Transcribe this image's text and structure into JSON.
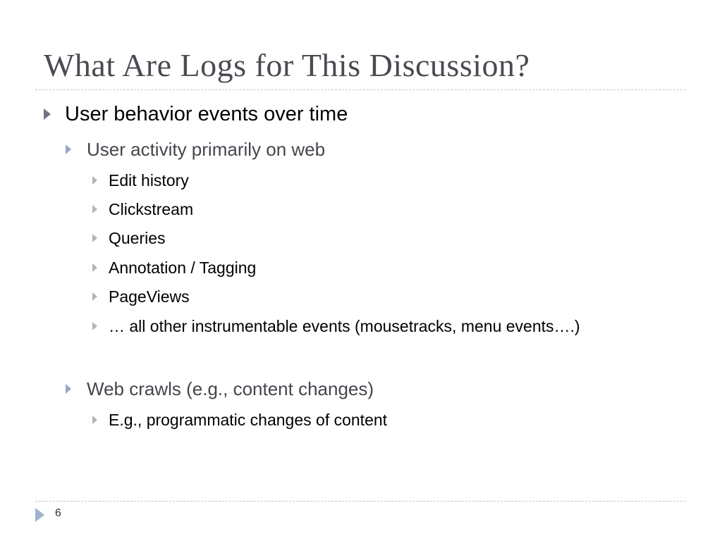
{
  "slide": {
    "title": "What Are Logs for This Discussion?",
    "page_number": "6",
    "bullets": [
      {
        "level": 1,
        "text": "User behavior events over time"
      },
      {
        "level": 2,
        "text": "User activity primarily on web"
      },
      {
        "level": 3,
        "text": "Edit history"
      },
      {
        "level": 3,
        "text": "Clickstream"
      },
      {
        "level": 3,
        "text": "Queries"
      },
      {
        "level": 3,
        "text": "Annotation / Tagging"
      },
      {
        "level": 3,
        "text": "PageViews"
      },
      {
        "level": 3,
        "text": "… all other instrumentable events (mousetracks, menu events….)"
      },
      {
        "level": 2,
        "text": "Web crawls (e.g., content changes)"
      },
      {
        "level": 3,
        "text": "E.g., programmatic changes of content"
      }
    ]
  }
}
